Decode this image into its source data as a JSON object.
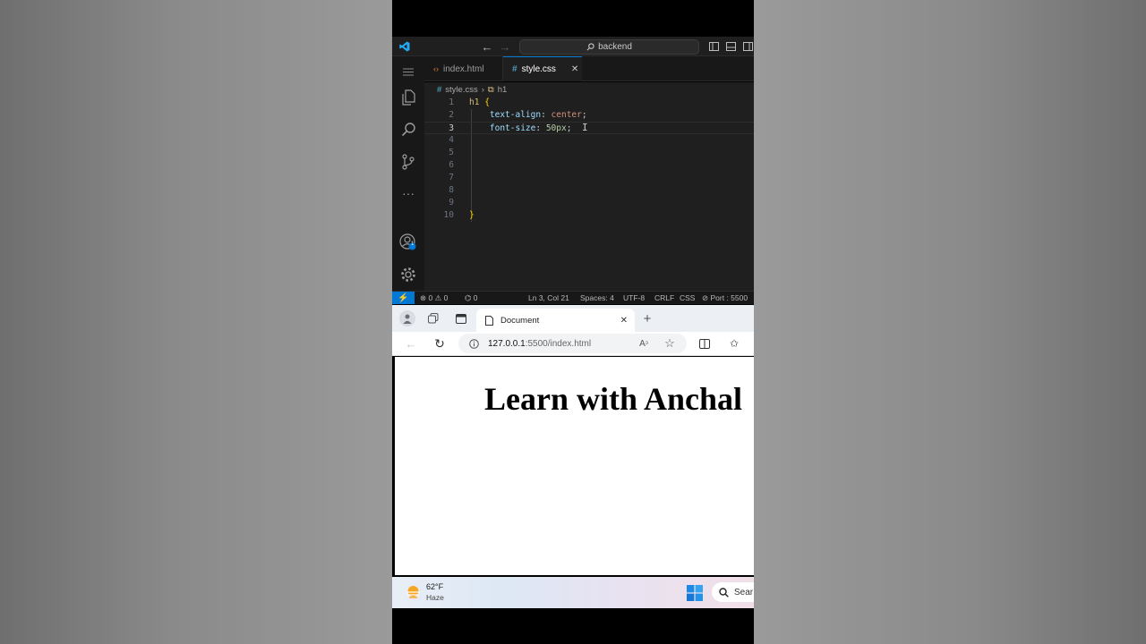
{
  "vscode": {
    "search_text": "backend",
    "tabs": [
      {
        "label": "index.html",
        "icon": "html-icon",
        "color": "#e37933"
      },
      {
        "label": "style.css",
        "icon": "css-icon",
        "color": "#519aba"
      }
    ],
    "tab_close_glyph": "✕",
    "breadcrumb": {
      "file": "style.css",
      "symbol": "h1"
    },
    "code_lines": [
      {
        "num": "1",
        "text": "h1 {"
      },
      {
        "num": "2",
        "text": "    text-align: center;"
      },
      {
        "num": "3",
        "text": "    font-size: 50px;"
      },
      {
        "num": "4",
        "text": ""
      },
      {
        "num": "5",
        "text": ""
      },
      {
        "num": "6",
        "text": ""
      },
      {
        "num": "7",
        "text": ""
      },
      {
        "num": "8",
        "text": ""
      },
      {
        "num": "9",
        "text": ""
      },
      {
        "num": "10",
        "text": "}"
      }
    ],
    "activity_badge": "1",
    "status": {
      "errors": "0",
      "warnings": "0",
      "ports": "0",
      "position": "Ln 3, Col 21",
      "spaces": "Spaces: 4",
      "encoding": "UTF-8",
      "eol": "CRLF",
      "language": "CSS",
      "port": "Port : 5500"
    },
    "colors": {
      "accent": "#0078d4",
      "editor_bg": "#1f1f1f",
      "selector": "#d7ba7d",
      "property": "#9cdcfe",
      "value": "#ce9178"
    }
  },
  "browser": {
    "tab_title": "Document",
    "url_host": "127.0.0.1",
    "url_rest": ":5500/index.html",
    "page_heading": "Learn with Anchal"
  },
  "taskbar": {
    "temperature": "62°F",
    "condition": "Haze",
    "search_label": "Sear"
  }
}
